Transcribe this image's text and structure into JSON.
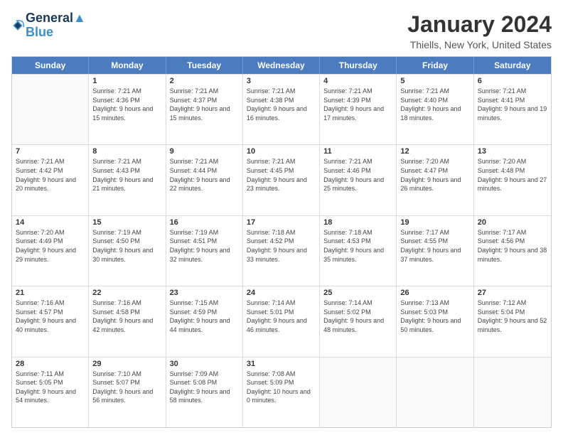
{
  "header": {
    "logo_line1": "General",
    "logo_line2": "Blue",
    "month_title": "January 2024",
    "location": "Thiells, New York, United States"
  },
  "calendar": {
    "days_of_week": [
      "Sunday",
      "Monday",
      "Tuesday",
      "Wednesday",
      "Thursday",
      "Friday",
      "Saturday"
    ],
    "weeks": [
      [
        {
          "day": "",
          "sunrise": "",
          "sunset": "",
          "daylight": ""
        },
        {
          "day": "1",
          "sunrise": "7:21 AM",
          "sunset": "4:36 PM",
          "daylight": "9 hours and 15 minutes."
        },
        {
          "day": "2",
          "sunrise": "7:21 AM",
          "sunset": "4:37 PM",
          "daylight": "9 hours and 15 minutes."
        },
        {
          "day": "3",
          "sunrise": "7:21 AM",
          "sunset": "4:38 PM",
          "daylight": "9 hours and 16 minutes."
        },
        {
          "day": "4",
          "sunrise": "7:21 AM",
          "sunset": "4:39 PM",
          "daylight": "9 hours and 17 minutes."
        },
        {
          "day": "5",
          "sunrise": "7:21 AM",
          "sunset": "4:40 PM",
          "daylight": "9 hours and 18 minutes."
        },
        {
          "day": "6",
          "sunrise": "7:21 AM",
          "sunset": "4:41 PM",
          "daylight": "9 hours and 19 minutes."
        }
      ],
      [
        {
          "day": "7",
          "sunrise": "7:21 AM",
          "sunset": "4:42 PM",
          "daylight": "9 hours and 20 minutes."
        },
        {
          "day": "8",
          "sunrise": "7:21 AM",
          "sunset": "4:43 PM",
          "daylight": "9 hours and 21 minutes."
        },
        {
          "day": "9",
          "sunrise": "7:21 AM",
          "sunset": "4:44 PM",
          "daylight": "9 hours and 22 minutes."
        },
        {
          "day": "10",
          "sunrise": "7:21 AM",
          "sunset": "4:45 PM",
          "daylight": "9 hours and 23 minutes."
        },
        {
          "day": "11",
          "sunrise": "7:21 AM",
          "sunset": "4:46 PM",
          "daylight": "9 hours and 25 minutes."
        },
        {
          "day": "12",
          "sunrise": "7:20 AM",
          "sunset": "4:47 PM",
          "daylight": "9 hours and 26 minutes."
        },
        {
          "day": "13",
          "sunrise": "7:20 AM",
          "sunset": "4:48 PM",
          "daylight": "9 hours and 27 minutes."
        }
      ],
      [
        {
          "day": "14",
          "sunrise": "7:20 AM",
          "sunset": "4:49 PM",
          "daylight": "9 hours and 29 minutes."
        },
        {
          "day": "15",
          "sunrise": "7:19 AM",
          "sunset": "4:50 PM",
          "daylight": "9 hours and 30 minutes."
        },
        {
          "day": "16",
          "sunrise": "7:19 AM",
          "sunset": "4:51 PM",
          "daylight": "9 hours and 32 minutes."
        },
        {
          "day": "17",
          "sunrise": "7:18 AM",
          "sunset": "4:52 PM",
          "daylight": "9 hours and 33 minutes."
        },
        {
          "day": "18",
          "sunrise": "7:18 AM",
          "sunset": "4:53 PM",
          "daylight": "9 hours and 35 minutes."
        },
        {
          "day": "19",
          "sunrise": "7:17 AM",
          "sunset": "4:55 PM",
          "daylight": "9 hours and 37 minutes."
        },
        {
          "day": "20",
          "sunrise": "7:17 AM",
          "sunset": "4:56 PM",
          "daylight": "9 hours and 38 minutes."
        }
      ],
      [
        {
          "day": "21",
          "sunrise": "7:16 AM",
          "sunset": "4:57 PM",
          "daylight": "9 hours and 40 minutes."
        },
        {
          "day": "22",
          "sunrise": "7:16 AM",
          "sunset": "4:58 PM",
          "daylight": "9 hours and 42 minutes."
        },
        {
          "day": "23",
          "sunrise": "7:15 AM",
          "sunset": "4:59 PM",
          "daylight": "9 hours and 44 minutes."
        },
        {
          "day": "24",
          "sunrise": "7:14 AM",
          "sunset": "5:01 PM",
          "daylight": "9 hours and 46 minutes."
        },
        {
          "day": "25",
          "sunrise": "7:14 AM",
          "sunset": "5:02 PM",
          "daylight": "9 hours and 48 minutes."
        },
        {
          "day": "26",
          "sunrise": "7:13 AM",
          "sunset": "5:03 PM",
          "daylight": "9 hours and 50 minutes."
        },
        {
          "day": "27",
          "sunrise": "7:12 AM",
          "sunset": "5:04 PM",
          "daylight": "9 hours and 52 minutes."
        }
      ],
      [
        {
          "day": "28",
          "sunrise": "7:11 AM",
          "sunset": "5:05 PM",
          "daylight": "9 hours and 54 minutes."
        },
        {
          "day": "29",
          "sunrise": "7:10 AM",
          "sunset": "5:07 PM",
          "daylight": "9 hours and 56 minutes."
        },
        {
          "day": "30",
          "sunrise": "7:09 AM",
          "sunset": "5:08 PM",
          "daylight": "9 hours and 58 minutes."
        },
        {
          "day": "31",
          "sunrise": "7:08 AM",
          "sunset": "5:09 PM",
          "daylight": "10 hours and 0 minutes."
        },
        {
          "day": "",
          "sunrise": "",
          "sunset": "",
          "daylight": ""
        },
        {
          "day": "",
          "sunrise": "",
          "sunset": "",
          "daylight": ""
        },
        {
          "day": "",
          "sunrise": "",
          "sunset": "",
          "daylight": ""
        }
      ]
    ]
  }
}
